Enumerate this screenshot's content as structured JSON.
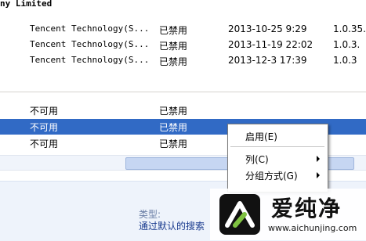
{
  "header": {
    "title": "ny Limited"
  },
  "rows_top": [
    {
      "publisher": "Tencent Technology(S...",
      "status": "已禁用",
      "date": "2013-10-25 9:29",
      "version": "1.0.35."
    },
    {
      "publisher": "Tencent Technology(S...",
      "status": "已禁用",
      "date": "2013-11-19 22:02",
      "version": "1.0.3."
    },
    {
      "publisher": "Tencent Technology(S...",
      "status": "已禁用",
      "date": "2013-12-3 17:39",
      "version": "1.0.3"
    }
  ],
  "rows_bottom": [
    {
      "publisher": "不可用",
      "status": "已禁用"
    },
    {
      "publisher": "不可用",
      "status": "已禁用",
      "selected": true
    },
    {
      "publisher": "不可用",
      "status": "已禁用"
    }
  ],
  "context_menu": {
    "items": [
      {
        "label": "启用(E)",
        "submenu": false
      },
      {
        "label": "列(C)",
        "submenu": true
      },
      {
        "label": "分组方式(G)",
        "submenu": true
      }
    ]
  },
  "details": {
    "type_label": "类型:",
    "description": "通过默认的搜索"
  },
  "watermark": {
    "text": "爱纯净",
    "url": "www.aichunjing.com"
  },
  "colors": {
    "selection": "#316ac5",
    "details_bg": "#eef3fb"
  }
}
